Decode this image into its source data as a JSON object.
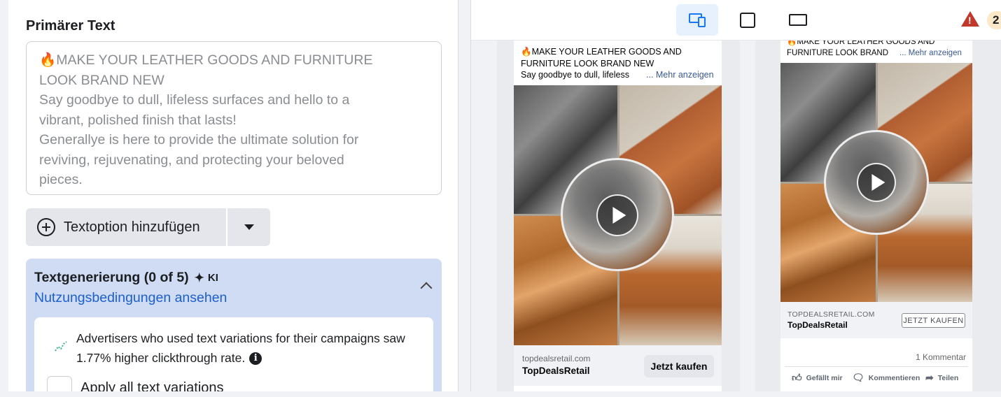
{
  "left": {
    "section_title": "Primärer Text",
    "primary_text": {
      "line1_emoji": "🔥",
      "line1": "MAKE YOUR LEATHER GOODS AND FURNITURE",
      "line2": "LOOK BRAND NEW",
      "line3": "Say goodbye to dull, lifeless surfaces and hello to a",
      "line4": "vibrant, polished finish that lasts!",
      "line5": "Generallye is here to provide the ultimate solution for",
      "line6": "reviving, rejuvenating, and protecting your beloved",
      "line7": "pieces."
    },
    "add_text_option": "Textoption hinzufügen",
    "generation": {
      "title": "Textgenerierung (0 of 5)",
      "ki": "KI",
      "terms_link": "Nutzungsbedingungen ansehen",
      "message_line1": "Advertisers who used text variations for their campaigns saw",
      "message_line2": "1.77% higher clickthrough rate.",
      "info": "i",
      "apply_all": "Apply all text variations"
    }
  },
  "toolbar": {
    "warning_count": "2"
  },
  "preview1": {
    "text_line1_emoji": "🔥",
    "text_line1": "MAKE YOUR LEATHER GOODS AND",
    "text_line2": "FURNITURE LOOK BRAND NEW",
    "text_line3": "Say goodbye to dull, lifeless",
    "more": "... Mehr anzeigen",
    "domain": "topdealsretail.com",
    "brand": "TopDealsRetail",
    "cta": "Jetzt kaufen"
  },
  "preview2": {
    "text_line1_emoji": "🔥",
    "text_line1": "MAKE YOUR LEATHER GOODS AND",
    "text_line2": "FURNITURE LOOK BRAND",
    "more": "... Mehr anzeigen",
    "domain": "TOPDEALSRETAIL.COM",
    "brand": "TopDealsRetail",
    "cta": "JETZT KAUFEN",
    "comments": "1 Kommentar",
    "like": "Gefällt mir",
    "comment": "Kommentieren",
    "share": "Teilen"
  }
}
